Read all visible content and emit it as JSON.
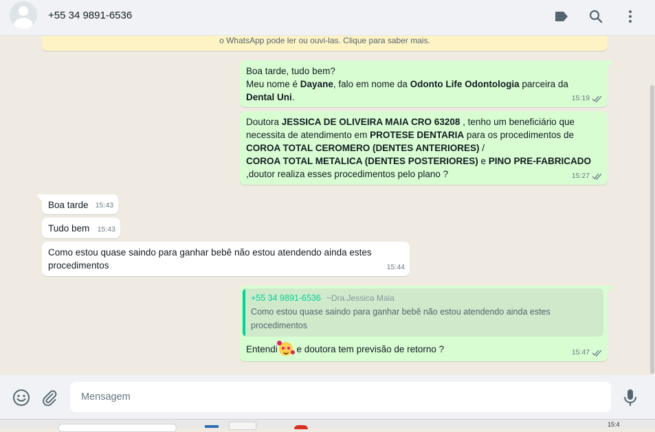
{
  "header": {
    "contact_name": "+55 34 9891-6536"
  },
  "banner": {
    "text": "o WhatsApp pode ler ou ouvi-las. Clique para saber mais."
  },
  "messages": {
    "m1": {
      "line1": "Boa tarde, tudo bem?",
      "pre": "Meu nome é ",
      "name": "Dayane",
      "mid": ", falo em nome da ",
      "company": "Odonto Life Odontologia",
      "mid2": " parceira da ",
      "plan": "Dental Uni",
      "end": ".",
      "time": "15:19"
    },
    "m2": {
      "pre": "Doutora ",
      "doctor": "JESSICA DE OLIVEIRA MAIA  CRO 63208",
      "mid": " , tenho um beneficiário que necessita de atendimento em ",
      "service": "PROTESE DENTARIA",
      "mid2": " para os procedimentos de ",
      "proc1": "COROA TOTAL CEROMERO (DENTES ANTERIORES)",
      "sep": " /",
      "proc2": "COROA TOTAL METALICA (DENTES POSTERIORES)",
      "and": " e ",
      "proc3": "PINO PRE-FABRICADO",
      "end": ",doutor realiza esses procedimentos pelo plano ?",
      "time": "15:27"
    },
    "m3": {
      "text": "Boa tarde",
      "time": "15:43"
    },
    "m4": {
      "text": "Tudo bem",
      "time": "15:43"
    },
    "m5": {
      "text": "Como estou quase saindo para ganhar bebê não estou atendendo ainda estes procedimentos",
      "time": "15:44"
    },
    "m6": {
      "quote_name": "+55 34 9891-6536",
      "quote_alias": "~Dra.Jessica Maia",
      "quote_text": "Como estou quase saindo para ganhar bebê não estou atendendo ainda estes procedimentos",
      "pre": "Entendi",
      "post": " e doutora  tem previsão de retorno ?",
      "time": "15:47"
    }
  },
  "composer": {
    "placeholder": "Mensagem"
  },
  "taskbar": {
    "right_text": "15:4"
  },
  "icons": {
    "header": [
      "label-icon",
      "search-icon",
      "menu-dots-icon"
    ],
    "footer": [
      "emoji-icon",
      "attach-icon",
      "mic-icon"
    ]
  },
  "colors": {
    "outgoing_bubble": "#d9fdd3",
    "incoming_bubble": "#ffffff",
    "chat_background": "#efeae2",
    "header_background": "#f0f2f5",
    "quote_accent": "#06cf9c",
    "tick_color": "#667781"
  }
}
